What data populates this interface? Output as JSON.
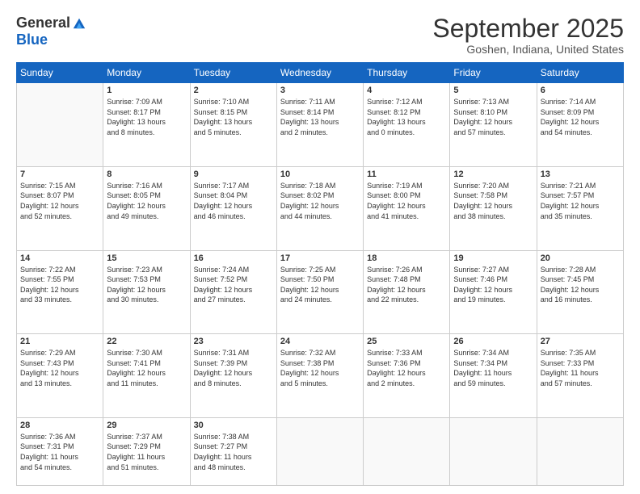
{
  "logo": {
    "general": "General",
    "blue": "Blue"
  },
  "title": "September 2025",
  "subtitle": "Goshen, Indiana, United States",
  "days_header": [
    "Sunday",
    "Monday",
    "Tuesday",
    "Wednesday",
    "Thursday",
    "Friday",
    "Saturday"
  ],
  "weeks": [
    [
      {
        "num": "",
        "info": ""
      },
      {
        "num": "1",
        "info": "Sunrise: 7:09 AM\nSunset: 8:17 PM\nDaylight: 13 hours\nand 8 minutes."
      },
      {
        "num": "2",
        "info": "Sunrise: 7:10 AM\nSunset: 8:15 PM\nDaylight: 13 hours\nand 5 minutes."
      },
      {
        "num": "3",
        "info": "Sunrise: 7:11 AM\nSunset: 8:14 PM\nDaylight: 13 hours\nand 2 minutes."
      },
      {
        "num": "4",
        "info": "Sunrise: 7:12 AM\nSunset: 8:12 PM\nDaylight: 13 hours\nand 0 minutes."
      },
      {
        "num": "5",
        "info": "Sunrise: 7:13 AM\nSunset: 8:10 PM\nDaylight: 12 hours\nand 57 minutes."
      },
      {
        "num": "6",
        "info": "Sunrise: 7:14 AM\nSunset: 8:09 PM\nDaylight: 12 hours\nand 54 minutes."
      }
    ],
    [
      {
        "num": "7",
        "info": "Sunrise: 7:15 AM\nSunset: 8:07 PM\nDaylight: 12 hours\nand 52 minutes."
      },
      {
        "num": "8",
        "info": "Sunrise: 7:16 AM\nSunset: 8:05 PM\nDaylight: 12 hours\nand 49 minutes."
      },
      {
        "num": "9",
        "info": "Sunrise: 7:17 AM\nSunset: 8:04 PM\nDaylight: 12 hours\nand 46 minutes."
      },
      {
        "num": "10",
        "info": "Sunrise: 7:18 AM\nSunset: 8:02 PM\nDaylight: 12 hours\nand 44 minutes."
      },
      {
        "num": "11",
        "info": "Sunrise: 7:19 AM\nSunset: 8:00 PM\nDaylight: 12 hours\nand 41 minutes."
      },
      {
        "num": "12",
        "info": "Sunrise: 7:20 AM\nSunset: 7:58 PM\nDaylight: 12 hours\nand 38 minutes."
      },
      {
        "num": "13",
        "info": "Sunrise: 7:21 AM\nSunset: 7:57 PM\nDaylight: 12 hours\nand 35 minutes."
      }
    ],
    [
      {
        "num": "14",
        "info": "Sunrise: 7:22 AM\nSunset: 7:55 PM\nDaylight: 12 hours\nand 33 minutes."
      },
      {
        "num": "15",
        "info": "Sunrise: 7:23 AM\nSunset: 7:53 PM\nDaylight: 12 hours\nand 30 minutes."
      },
      {
        "num": "16",
        "info": "Sunrise: 7:24 AM\nSunset: 7:52 PM\nDaylight: 12 hours\nand 27 minutes."
      },
      {
        "num": "17",
        "info": "Sunrise: 7:25 AM\nSunset: 7:50 PM\nDaylight: 12 hours\nand 24 minutes."
      },
      {
        "num": "18",
        "info": "Sunrise: 7:26 AM\nSunset: 7:48 PM\nDaylight: 12 hours\nand 22 minutes."
      },
      {
        "num": "19",
        "info": "Sunrise: 7:27 AM\nSunset: 7:46 PM\nDaylight: 12 hours\nand 19 minutes."
      },
      {
        "num": "20",
        "info": "Sunrise: 7:28 AM\nSunset: 7:45 PM\nDaylight: 12 hours\nand 16 minutes."
      }
    ],
    [
      {
        "num": "21",
        "info": "Sunrise: 7:29 AM\nSunset: 7:43 PM\nDaylight: 12 hours\nand 13 minutes."
      },
      {
        "num": "22",
        "info": "Sunrise: 7:30 AM\nSunset: 7:41 PM\nDaylight: 12 hours\nand 11 minutes."
      },
      {
        "num": "23",
        "info": "Sunrise: 7:31 AM\nSunset: 7:39 PM\nDaylight: 12 hours\nand 8 minutes."
      },
      {
        "num": "24",
        "info": "Sunrise: 7:32 AM\nSunset: 7:38 PM\nDaylight: 12 hours\nand 5 minutes."
      },
      {
        "num": "25",
        "info": "Sunrise: 7:33 AM\nSunset: 7:36 PM\nDaylight: 12 hours\nand 2 minutes."
      },
      {
        "num": "26",
        "info": "Sunrise: 7:34 AM\nSunset: 7:34 PM\nDaylight: 11 hours\nand 59 minutes."
      },
      {
        "num": "27",
        "info": "Sunrise: 7:35 AM\nSunset: 7:33 PM\nDaylight: 11 hours\nand 57 minutes."
      }
    ],
    [
      {
        "num": "28",
        "info": "Sunrise: 7:36 AM\nSunset: 7:31 PM\nDaylight: 11 hours\nand 54 minutes."
      },
      {
        "num": "29",
        "info": "Sunrise: 7:37 AM\nSunset: 7:29 PM\nDaylight: 11 hours\nand 51 minutes."
      },
      {
        "num": "30",
        "info": "Sunrise: 7:38 AM\nSunset: 7:27 PM\nDaylight: 11 hours\nand 48 minutes."
      },
      {
        "num": "",
        "info": ""
      },
      {
        "num": "",
        "info": ""
      },
      {
        "num": "",
        "info": ""
      },
      {
        "num": "",
        "info": ""
      }
    ]
  ]
}
